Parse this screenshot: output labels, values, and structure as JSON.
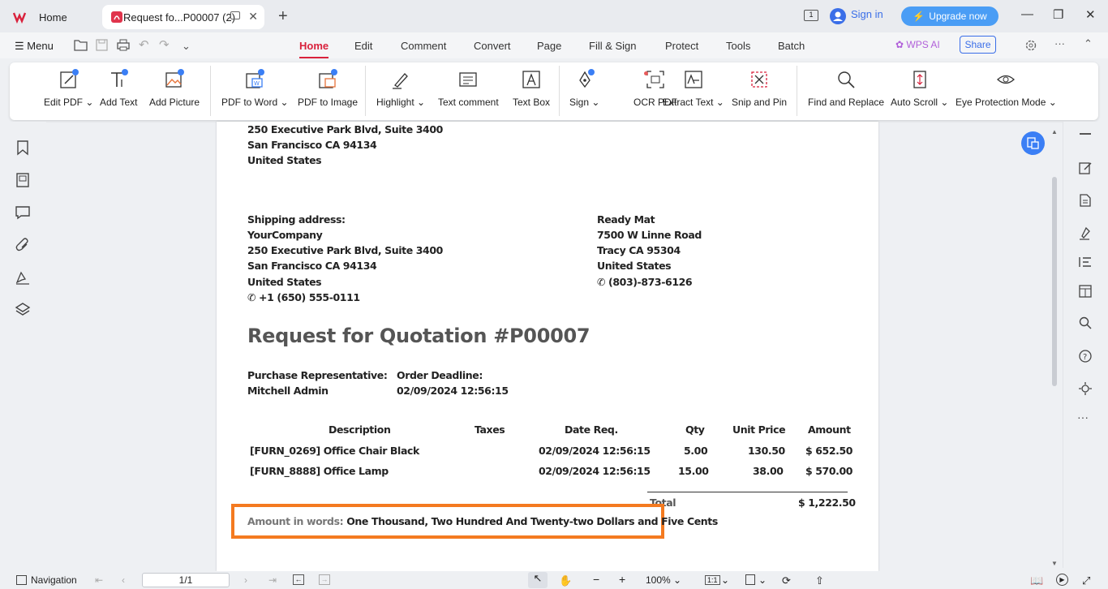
{
  "tabs": {
    "home": "Home",
    "doc": "Request fo...P00007 (2)",
    "new": "+"
  },
  "window": {
    "sign_in": "Sign in",
    "upgrade": "Upgrade now",
    "minimize": "—",
    "restore": "❐",
    "close": "✕"
  },
  "menu": {
    "label": "Menu"
  },
  "ribbon_tabs": [
    "Home",
    "Edit",
    "Comment",
    "Convert",
    "Page",
    "Fill & Sign",
    "Protect",
    "Tools",
    "Batch"
  ],
  "wps_ai": "WPS AI",
  "share": "Share",
  "tools": {
    "edit_pdf": "Edit PDF",
    "add_text": "Add Text",
    "add_picture": "Add Picture",
    "pdf_to_word": "PDF to Word",
    "pdf_to_image": "PDF to Image",
    "highlight": "Highlight",
    "text_comment": "Text comment",
    "text_box": "Text Box",
    "sign": "Sign",
    "ocr_pdf": "OCR PDF",
    "extract_text": "Extract Text",
    "snip_and_pin": "Snip and Pin",
    "find_and_replace": "Find and Replace",
    "auto_scroll": "Auto Scroll",
    "eye_protection": "Eye Protection Mode"
  },
  "doc": {
    "vendor_addr": [
      "250 Executive Park Blvd, Suite 3400",
      "San Francisco CA 94134",
      "United States"
    ],
    "shipping_label": "Shipping address:",
    "shipping": [
      "YourCompany",
      "250 Executive Park Blvd, Suite 3400",
      "San Francisco CA 94134",
      "United States"
    ],
    "shipping_phone": "+1 (650) 555-0111",
    "vendor": [
      "Ready Mat",
      "7500 W Linne Road",
      "Tracy CA 95304",
      "United States"
    ],
    "vendor_phone": "(803)-873-6126",
    "title": "Request for Quotation #P00007",
    "rep_label": "Purchase Representative:",
    "rep": "Mitchell Admin",
    "deadline_label": "Order Deadline:",
    "deadline": "02/09/2024 12:56:15",
    "table": {
      "headers": [
        "Description",
        "Taxes",
        "Date Req.",
        "Qty",
        "Unit Price",
        "Amount"
      ],
      "rows": [
        [
          "[FURN_0269] Office Chair Black",
          "",
          "02/09/2024 12:56:15",
          "5.00",
          "130.50",
          "$ 652.50"
        ],
        [
          "[FURN_8888] Office Lamp",
          "",
          "02/09/2024 12:56:15",
          "15.00",
          "38.00",
          "$ 570.00"
        ]
      ]
    },
    "total_label": "Total",
    "total": "$ 1,222.50",
    "words_label": "Amount in words:",
    "words": "One Thousand, Two Hundred And Twenty-two Dollars and Five Cents"
  },
  "status": {
    "navigation": "Navigation",
    "page": "1/1",
    "zoom": "100%",
    "ratio": "1:1"
  },
  "colors": {
    "accent": "#d9213c",
    "highlight_box": "#f47a20",
    "upgrade": "#4a9df5"
  }
}
